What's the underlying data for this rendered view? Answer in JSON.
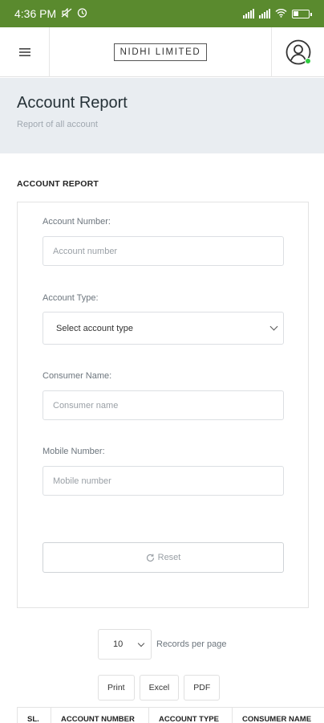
{
  "status_bar": {
    "time": "4:36 PM",
    "icons": [
      "mute-icon",
      "alarm-icon",
      "signal-icon",
      "signal-icon",
      "wifi-icon",
      "battery-icon"
    ],
    "background": "#5a8a2e"
  },
  "header": {
    "menu_icon": "hamburger-icon",
    "brand": "NIDHI LIMITED",
    "user_icon": "user-circle-icon",
    "online_color": "#2ecc40"
  },
  "page": {
    "title": "Account Report",
    "subtitle": "Report of all account"
  },
  "section": {
    "title": "ACCOUNT REPORT"
  },
  "form": {
    "account_number": {
      "label": "Account Number:",
      "placeholder": "Account number"
    },
    "account_type": {
      "label": "Account Type:",
      "selected": "Select account type"
    },
    "consumer_name": {
      "label": "Consumer Name:",
      "placeholder": "Consumer name"
    },
    "mobile_number": {
      "label": "Mobile Number:",
      "placeholder": "Mobile number"
    },
    "reset_label": "Reset",
    "reset_icon": "refresh-icon"
  },
  "records": {
    "value": "10",
    "label": "Records per page"
  },
  "export": {
    "print": "Print",
    "excel": "Excel",
    "pdf": "PDF"
  },
  "table": {
    "columns": [
      "SL.",
      "ACCOUNT NUMBER",
      "ACCOUNT TYPE",
      "CONSUMER NAME"
    ]
  }
}
